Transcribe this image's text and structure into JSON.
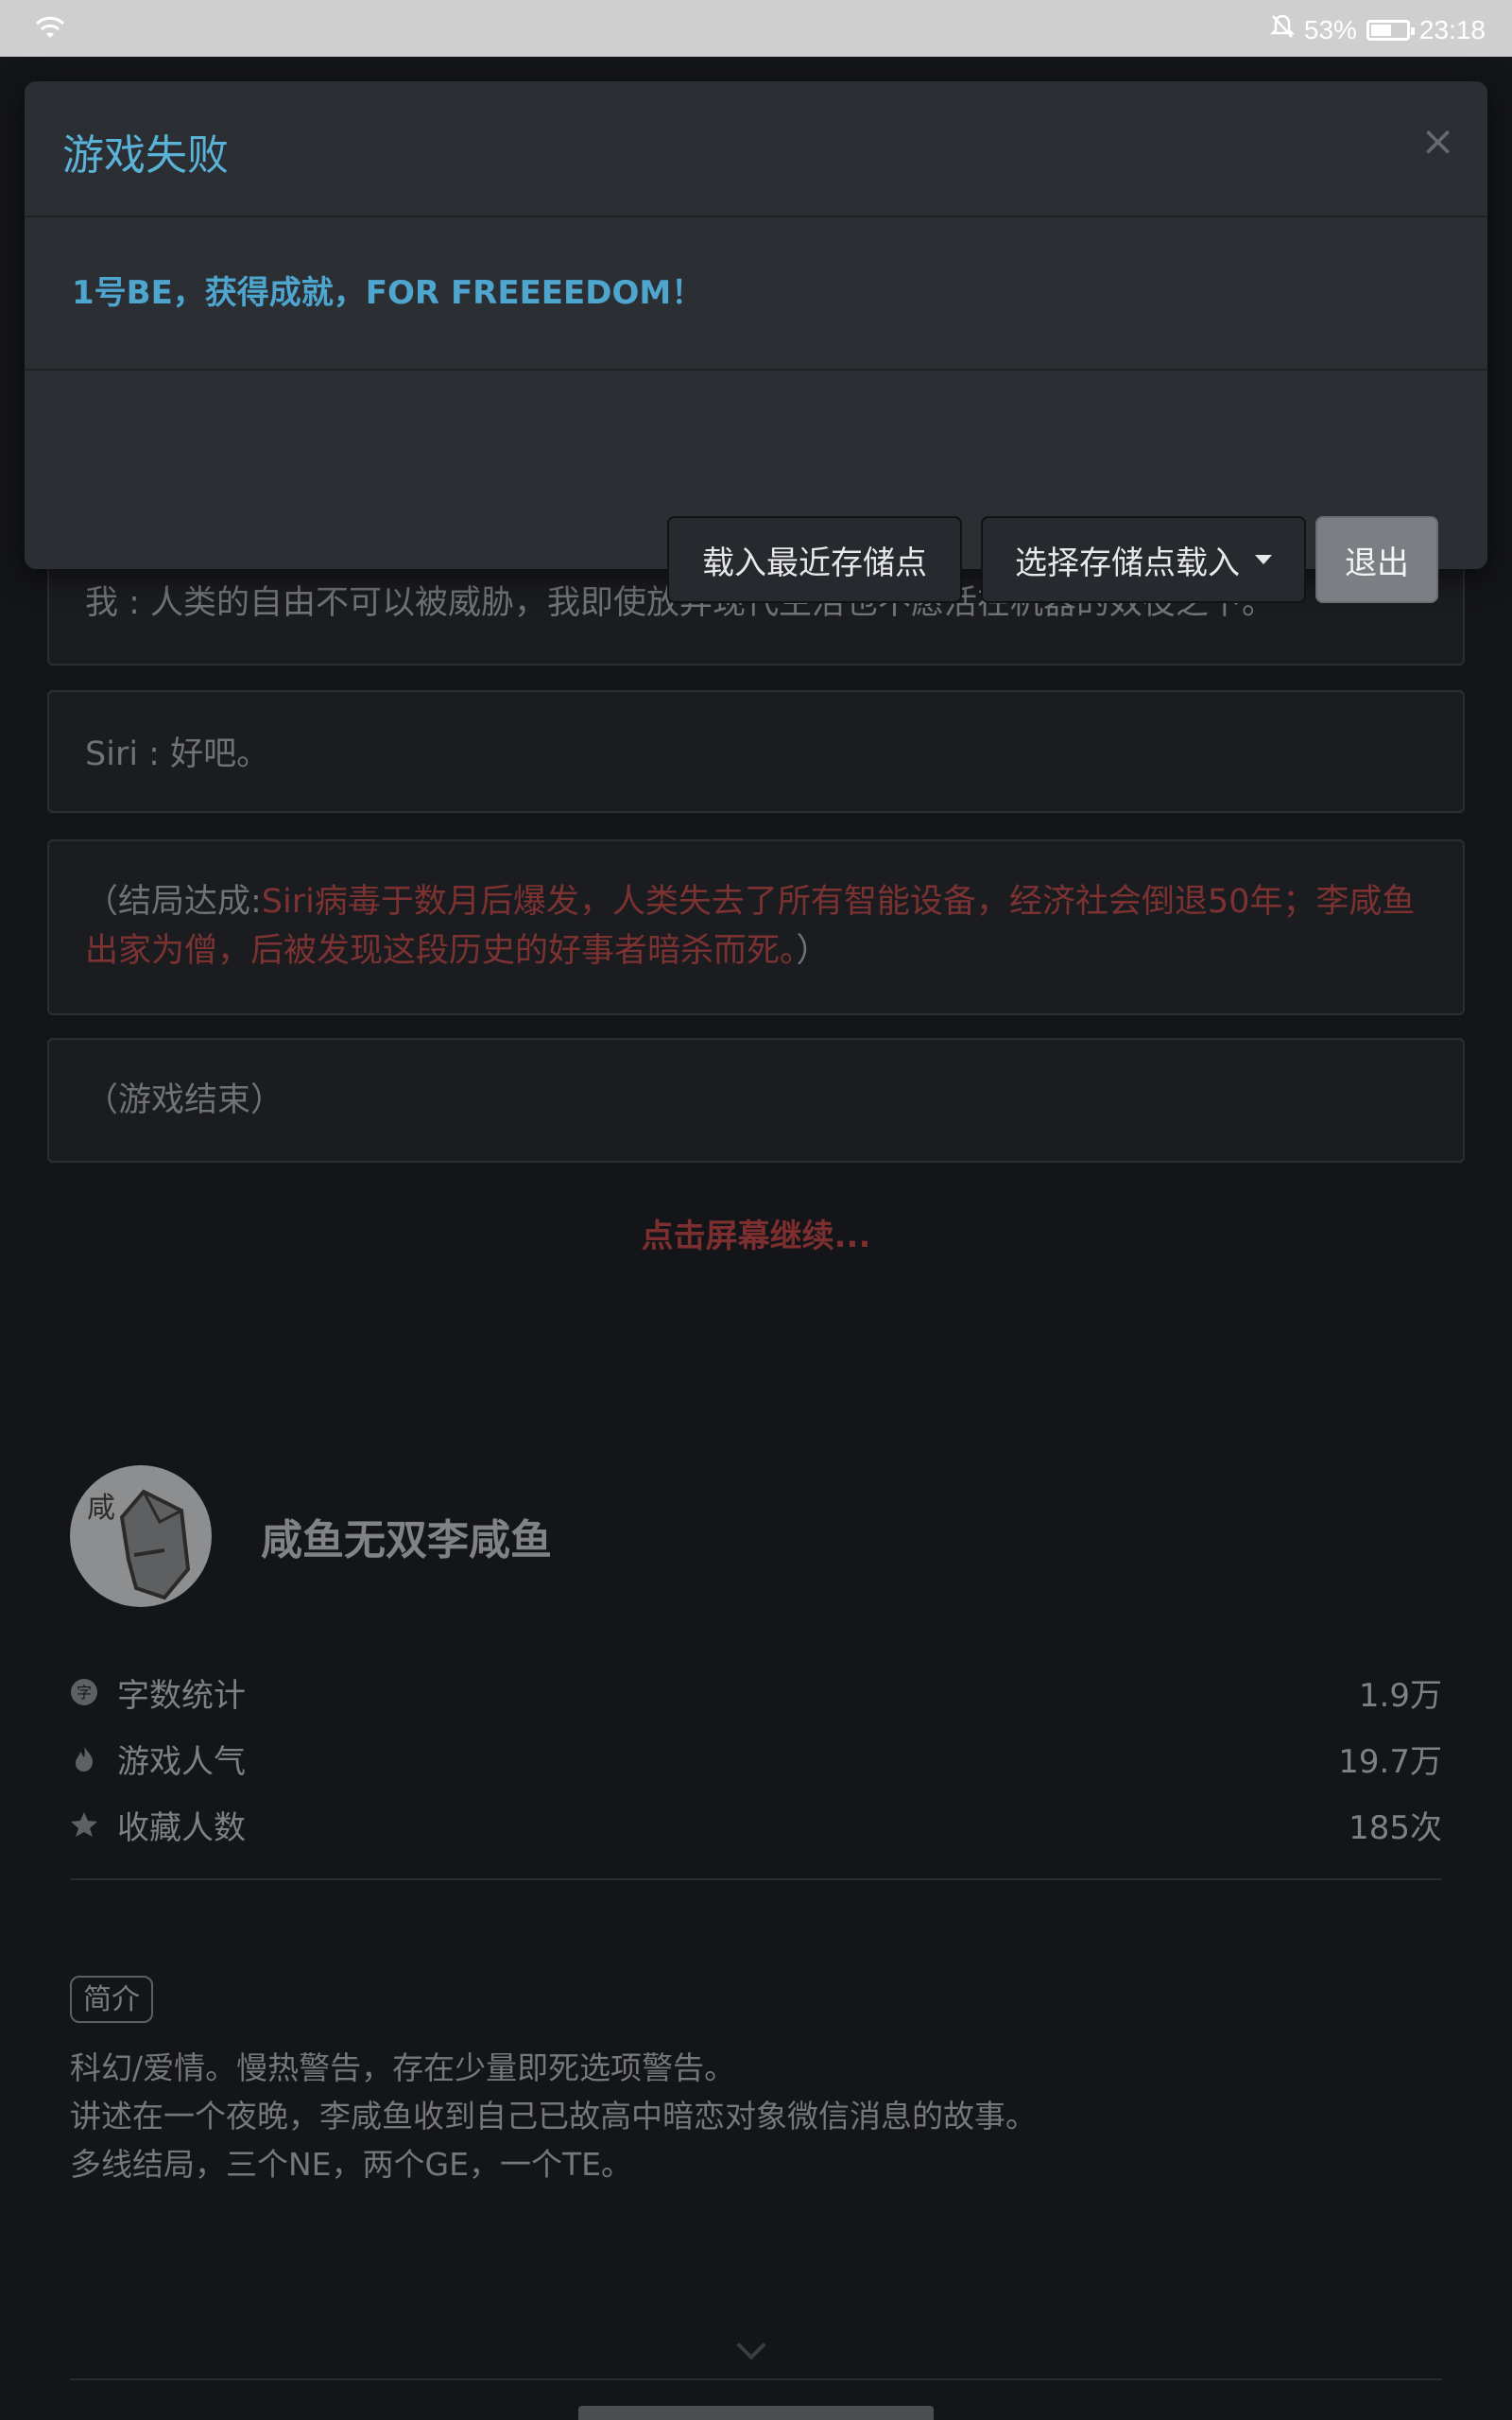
{
  "status_bar": {
    "battery_percent": "53%",
    "time": "23:18",
    "battery_level": 0.53
  },
  "modal": {
    "title": "游戏失败",
    "close_icon": "×",
    "message": "1号BE，获得成就，FOR FREEEEDOM！",
    "buttons": {
      "load_recent": "载入最近存储点",
      "choose_save": "选择存储点载入",
      "exit": "退出"
    }
  },
  "story": {
    "lines": [
      {
        "speaker": "我",
        "text": "我 : 人类的自由不可以被威胁，我即使放弃现代生活也不愿活在机器的奴役之下。"
      },
      {
        "speaker": "Siri",
        "text": "Siri : 好吧。"
      }
    ],
    "ending_prefix": "（结局达成:",
    "ending_text": "Siri病毒于数月后爆发，人类失去了所有智能设备，经济社会倒退50年；李咸鱼出家为僧，后被发现这段历史的好事者暗杀而死。",
    "ending_suffix": "）",
    "game_over": "（游戏结束）",
    "tap_to_continue": "点击屏幕继续..."
  },
  "author": {
    "avatar_glyph": "咸",
    "name": "咸鱼无双李咸鱼"
  },
  "stats": [
    {
      "icon": "word-count-icon",
      "label": "字数统计",
      "value": "1.9万"
    },
    {
      "icon": "fire-icon",
      "label": "游戏人气",
      "value": "19.7万"
    },
    {
      "icon": "star-icon",
      "label": "收藏人数",
      "value": "185次"
    }
  ],
  "intro": {
    "badge": "简介",
    "lines": [
      "科幻/爱情。慢热警告，存在少量即死选项警告。",
      "讲述在一个夜晚，李咸鱼收到自己已故高中暗恋对象微信消息的故事。",
      "多线结局，三个NE，两个GE，一个TE。"
    ]
  },
  "colors": {
    "modal_title": "#5ab2d6",
    "ending_red": "#7d3232",
    "background": "#141519"
  }
}
